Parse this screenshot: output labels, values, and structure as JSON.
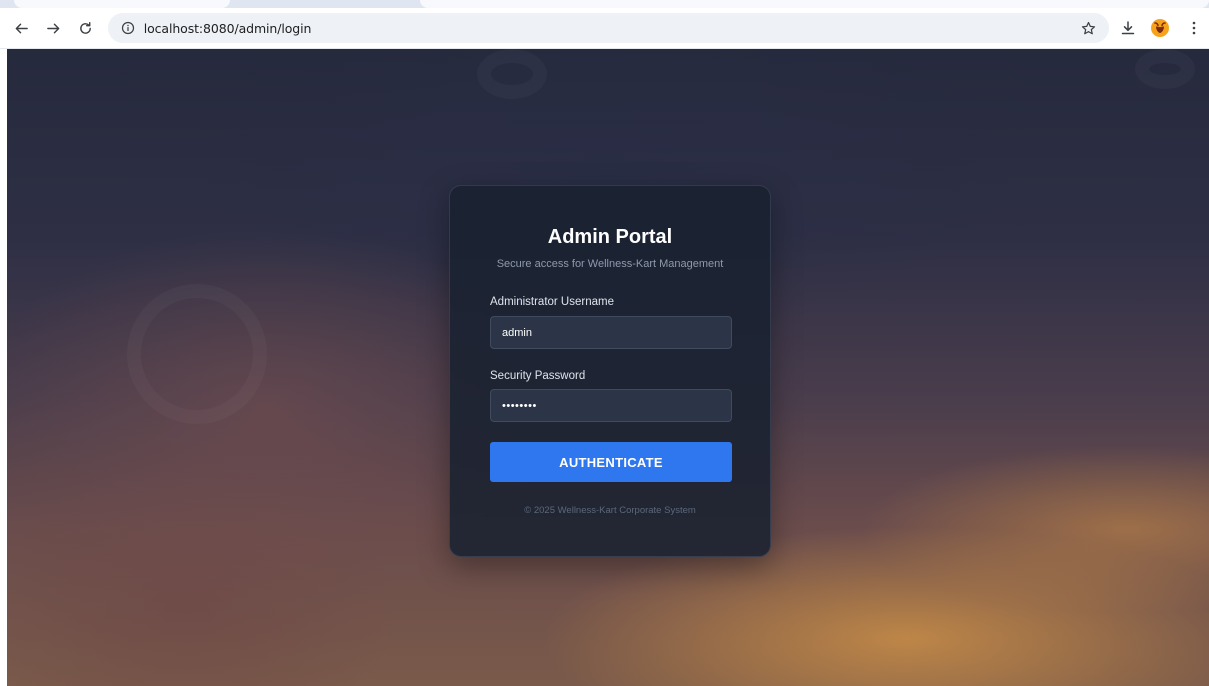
{
  "browser": {
    "url": "localhost:8080/admin/login",
    "icons": {
      "back": "arrow-left-icon",
      "forward": "arrow-right-icon",
      "reload": "reload-icon",
      "info": "info-icon",
      "bookmark": "star-icon",
      "download": "download-icon",
      "profile": "profile-avatar-icon",
      "menu": "kebab-menu-icon"
    }
  },
  "login": {
    "title": "Admin Portal",
    "subtitle": "Secure access for Wellness-Kart Management",
    "username_label": "Administrator Username",
    "username_value": "admin",
    "password_label": "Security Password",
    "password_value": "••••••••",
    "submit_label": "AUTHENTICATE",
    "footer": "© 2025 Wellness-Kart Corporate System"
  },
  "colors": {
    "accent": "#2f77ee",
    "card_bg": "#192130",
    "input_bg": "#2b3547"
  }
}
